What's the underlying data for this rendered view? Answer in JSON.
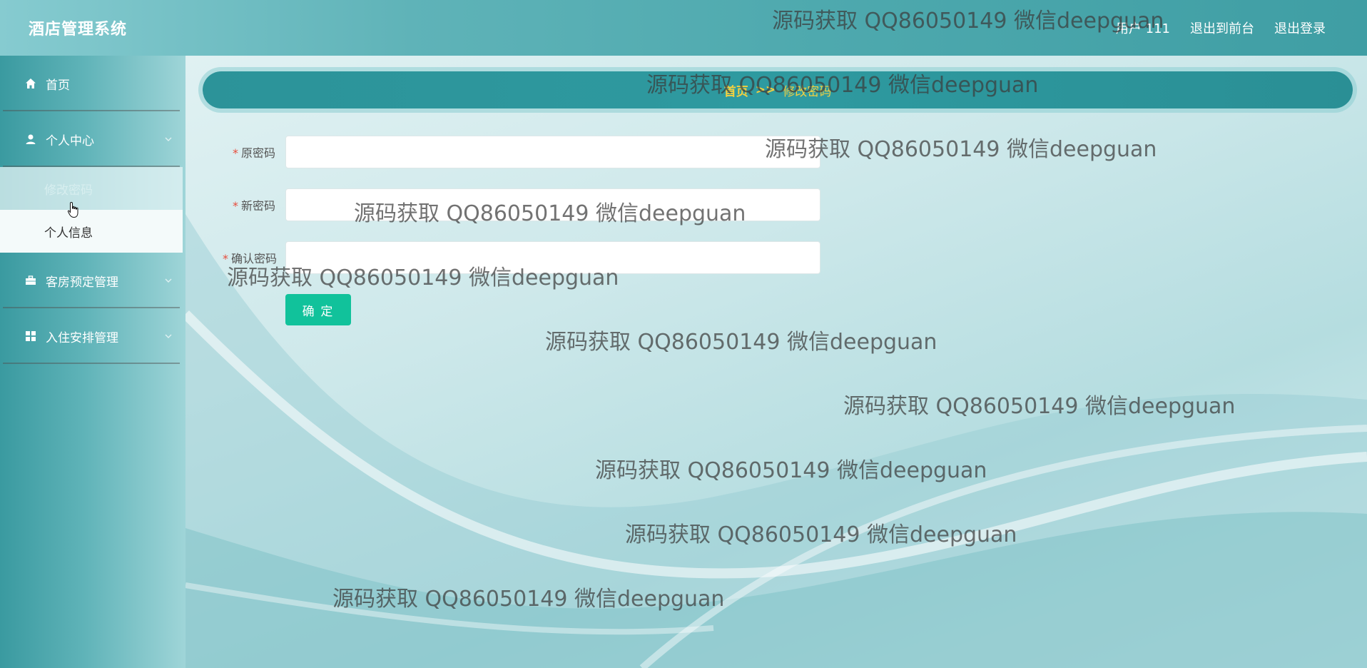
{
  "header": {
    "title": "酒店管理系统",
    "user_label": "用户 111",
    "front_link": "退出到前台",
    "logout_link": "退出登录"
  },
  "sidebar": {
    "items": [
      {
        "label": "首页",
        "icon": "home-icon"
      },
      {
        "label": "个人中心",
        "icon": "user-icon",
        "expanded": true,
        "children": [
          {
            "label": "修改密码",
            "active": true
          },
          {
            "label": "个人信息",
            "active": false
          }
        ]
      },
      {
        "label": "客房预定管理",
        "icon": "briefcase-icon"
      },
      {
        "label": "入住安排管理",
        "icon": "grid-icon"
      }
    ]
  },
  "breadcrumb": {
    "home": "首页",
    "separator": ">>",
    "current": "修改密码"
  },
  "form": {
    "old_password_label": "原密码",
    "new_password_label": "新密码",
    "confirm_password_label": "确认密码",
    "old_password_value": "",
    "new_password_value": "",
    "confirm_password_value": "",
    "submit_label": "确 定"
  },
  "watermark": {
    "text": "源码获取 QQ86050149 微信deepguan"
  },
  "colors": {
    "header_bg": "#4ea9ae",
    "breadcrumb_bg": "#2c9399",
    "breadcrumb_text": "#f4d03f",
    "submit_bg": "#11c29b",
    "required": "#e74c3c"
  }
}
